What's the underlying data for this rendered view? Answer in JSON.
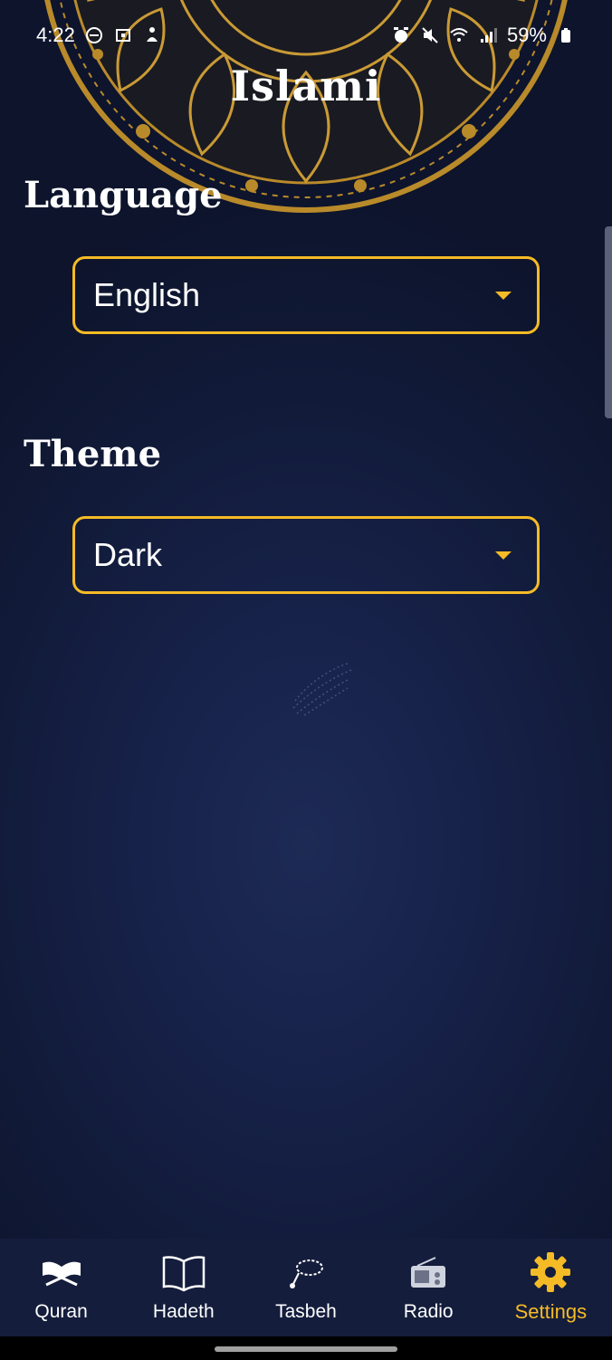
{
  "status_bar": {
    "time": "4:22",
    "battery": "59%",
    "left_icons": [
      "do-not-disturb-icon",
      "screenshot-icon",
      "accessibility-icon"
    ],
    "right_icons": [
      "alarm-icon",
      "mute-icon",
      "wifi-icon",
      "signal-icon",
      "battery-icon"
    ]
  },
  "app": {
    "title": "Islami"
  },
  "settings": {
    "language": {
      "title": "Language",
      "value": "English"
    },
    "theme": {
      "title": "Theme",
      "value": "Dark"
    }
  },
  "nav": {
    "items": [
      {
        "label": "Quran",
        "icon": "quran-icon",
        "active": false
      },
      {
        "label": "Hadeth",
        "icon": "book-icon",
        "active": false
      },
      {
        "label": "Tasbeh",
        "icon": "tasbeh-icon",
        "active": false
      },
      {
        "label": "Radio",
        "icon": "radio-icon",
        "active": false
      },
      {
        "label": "Settings",
        "icon": "gear-icon",
        "active": true
      }
    ]
  },
  "colors": {
    "accent": "#f5bb26",
    "background": "#141d3c",
    "text": "#ffffff",
    "mandala_gold": "#b98a2a"
  }
}
